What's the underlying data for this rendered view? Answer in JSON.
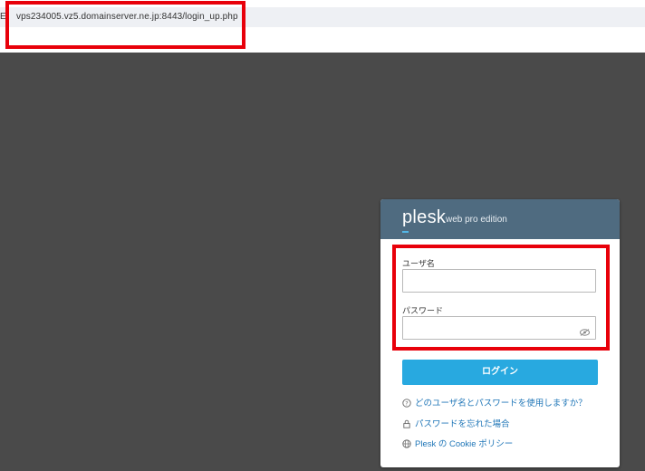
{
  "browser": {
    "address_prefix": "E",
    "url": "vps234005.vz5.domainserver.ne.jp:8443/login_up.php"
  },
  "login": {
    "logo": "plesk",
    "edition": "web pro edition",
    "username_label": "ユーザ名",
    "username_value": "",
    "password_label": "パスワード",
    "password_value": "",
    "login_button": "ログイン",
    "links": [
      {
        "icon": "help-circle-icon",
        "text": "どのユーザ名とパスワードを使用しますか？"
      },
      {
        "icon": "lock-icon",
        "text": "パスワードを忘れた場合"
      },
      {
        "icon": "globe-icon",
        "text": "Plesk の Cookie ポリシー"
      }
    ]
  },
  "colors": {
    "highlight": "#e8000a",
    "header": "#4f6b80",
    "button": "#28a9e0",
    "link": "#2177b8",
    "background": "#4a4a4a"
  }
}
